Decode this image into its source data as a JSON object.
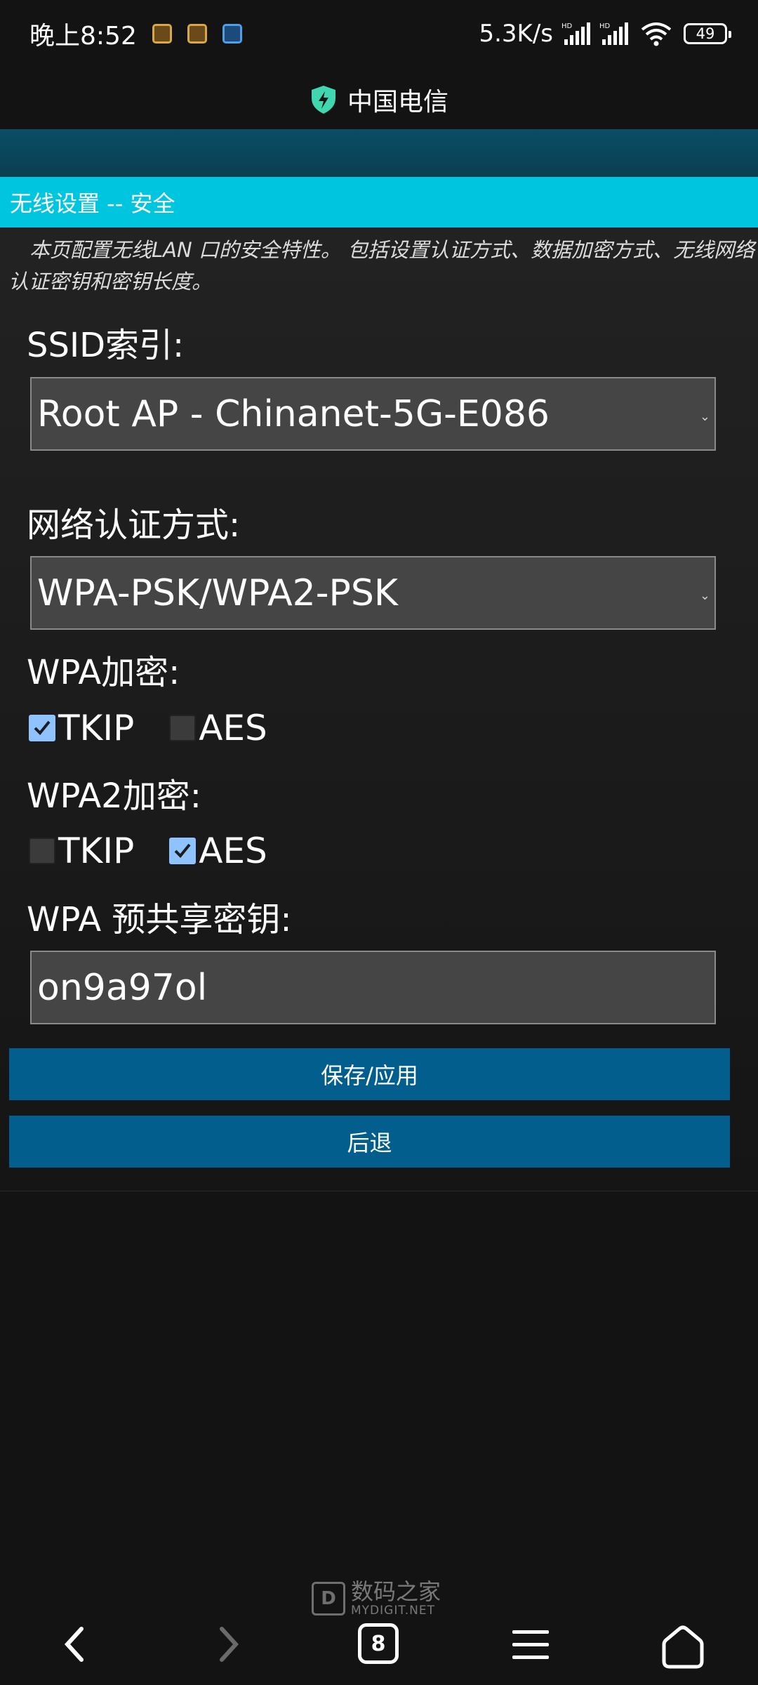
{
  "status_bar": {
    "time": "晚上8:52",
    "net_speed": "5.3K/s",
    "signal_1_label": "HD",
    "signal_2_label": "HD",
    "battery": "49"
  },
  "browser": {
    "title": "中国电信",
    "shield_color": "#3fd6b0"
  },
  "page": {
    "section_title": "无线设置 -- 安全",
    "description": "本页配置无线LAN 口的安全特性。 包括设置认证方式、数据加密方式、无线网络认证密钥和密钥长度。",
    "ssid_label": "SSID索引:",
    "ssid_value": "Root AP - Chinanet-5G-E086",
    "auth_label": "网络认证方式:",
    "auth_value": "WPA-PSK/WPA2-PSK",
    "wpa_label": "WPA加密:",
    "wpa_options": [
      {
        "label": "TKIP",
        "checked": true
      },
      {
        "label": "AES",
        "checked": false
      }
    ],
    "wpa2_label": "WPA2加密:",
    "wpa2_options": [
      {
        "label": "TKIP",
        "checked": false
      },
      {
        "label": "AES",
        "checked": true
      }
    ],
    "psk_label": "WPA 预共享密钥:",
    "psk_value": "on9a97ol",
    "save_button": "保存/应用",
    "back_button": "后退"
  },
  "watermark": {
    "logo_letter": "D",
    "name": "数码之家",
    "site": "MYDIGIT.NET"
  },
  "nav": {
    "tabs_count": "8",
    "icons": [
      "back-icon",
      "forward-icon",
      "tabs-icon",
      "menu-icon",
      "home-icon"
    ]
  }
}
